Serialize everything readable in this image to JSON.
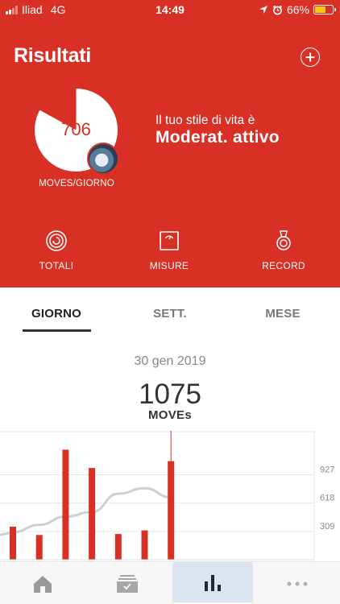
{
  "status_bar": {
    "carrier": "Iliad",
    "network": "4G",
    "time": "14:49",
    "battery": "66%",
    "battery_level": 0.66
  },
  "header": {
    "title": "Risultati"
  },
  "summary": {
    "moves_per_day": "706",
    "moves_label": "MOVES/GIORNO",
    "lifestyle_label": "Il tuo stile di vita è",
    "lifestyle_value": "Moderat. attivo",
    "ring_progress": 0.83
  },
  "quick_actions": [
    {
      "label": "TOTALI",
      "icon": "rings-icon"
    },
    {
      "label": "MISURE",
      "icon": "scale-icon"
    },
    {
      "label": "RECORD",
      "icon": "medal-icon"
    }
  ],
  "tabs": [
    {
      "label": "GIORNO",
      "active": true
    },
    {
      "label": "SETT.",
      "active": false
    },
    {
      "label": "MESE",
      "active": false
    }
  ],
  "detail": {
    "date": "30 gen 2019",
    "value": "1075",
    "unit": "MOVEs"
  },
  "colors": {
    "accent": "#d93025",
    "trend": "#c9d1d5"
  },
  "chart_data": {
    "type": "bar",
    "title": "",
    "xlabel": "",
    "ylabel": "",
    "values": [
      360,
      270,
      1200,
      1000,
      280,
      320,
      1075
    ],
    "trend": [
      300,
      380,
      470,
      520,
      720,
      780,
      680
    ],
    "reference_lines": [
      {
        "value": 927,
        "label": "927"
      },
      {
        "value": 618,
        "label": "618"
      },
      {
        "value": 309,
        "label": "309"
      }
    ],
    "selected_index": 6,
    "ylim": [
      0,
      1300
    ]
  },
  "nav": [
    {
      "icon": "home-icon",
      "active": false
    },
    {
      "icon": "inbox-icon",
      "active": false
    },
    {
      "icon": "chart-icon",
      "active": true
    },
    {
      "icon": "more-icon",
      "active": false
    }
  ]
}
